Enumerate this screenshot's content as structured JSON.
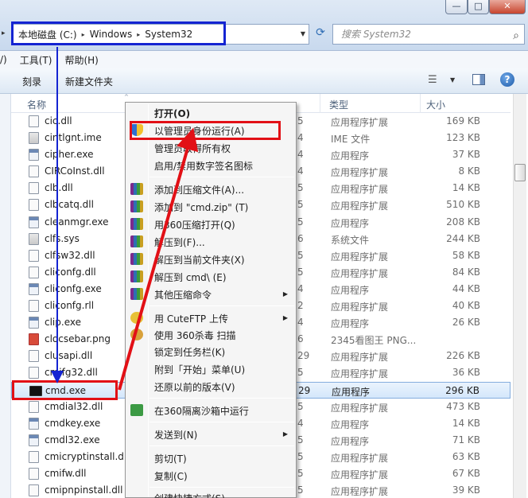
{
  "window": {
    "minimize": "—",
    "maximize": "□",
    "close": "✕"
  },
  "address": {
    "crumbs": [
      "本地磁盘 (C:)",
      "Windows",
      "System32"
    ],
    "separator": "▸"
  },
  "search": {
    "placeholder": "搜索 System32"
  },
  "menubar": [
    "/)",
    "工具(T)",
    "帮助(H)"
  ],
  "toolbar": {
    "burn": "刻录",
    "new_folder": "新建文件夹"
  },
  "columns": {
    "name": "名称",
    "type": "类型",
    "size": "大小"
  },
  "files": [
    {
      "name": "cic.dll",
      "num": "5",
      "type": "应用程序扩展",
      "size": "169 KB",
      "icon": "dll"
    },
    {
      "name": "cintlgnt.ime",
      "num": "4",
      "type": "IME 文件",
      "size": "123 KB",
      "icon": "sys"
    },
    {
      "name": "cipher.exe",
      "num": "4",
      "type": "应用程序",
      "size": "37 KB",
      "icon": "exe"
    },
    {
      "name": "CIRCoInst.dll",
      "num": "4",
      "type": "应用程序扩展",
      "size": "8 KB",
      "icon": "dll"
    },
    {
      "name": "clb.dll",
      "num": "5",
      "type": "应用程序扩展",
      "size": "14 KB",
      "icon": "dll"
    },
    {
      "name": "clbcatq.dll",
      "num": "5",
      "type": "应用程序扩展",
      "size": "510 KB",
      "icon": "dll"
    },
    {
      "name": "cleanmgr.exe",
      "num": "5",
      "type": "应用程序",
      "size": "208 KB",
      "icon": "exe"
    },
    {
      "name": "clfs.sys",
      "num": "6",
      "type": "系统文件",
      "size": "244 KB",
      "icon": "sys"
    },
    {
      "name": "clfsw32.dll",
      "num": "5",
      "type": "应用程序扩展",
      "size": "58 KB",
      "icon": "dll"
    },
    {
      "name": "cliconfg.dll",
      "num": "5",
      "type": "应用程序扩展",
      "size": "84 KB",
      "icon": "dll"
    },
    {
      "name": "cliconfg.exe",
      "num": "4",
      "type": "应用程序",
      "size": "44 KB",
      "icon": "exe"
    },
    {
      "name": "cliconfg.rll",
      "num": "2",
      "type": "应用程序扩展",
      "size": "40 KB",
      "icon": "dll"
    },
    {
      "name": "clip.exe",
      "num": "4",
      "type": "应用程序",
      "size": "26 KB",
      "icon": "exe"
    },
    {
      "name": "clocsebar.png",
      "num": "6",
      "type": "2345看图王 PNG...",
      "size": "",
      "icon": "png"
    },
    {
      "name": "clusapi.dll",
      "num": "29",
      "type": "应用程序扩展",
      "size": "226 KB",
      "icon": "dll"
    },
    {
      "name": "cmifg32.dll",
      "num": "5",
      "type": "应用程序扩展",
      "size": "36 KB",
      "icon": "dll"
    },
    {
      "name": "cmd.exe",
      "num": "29",
      "type": "应用程序",
      "size": "296 KB",
      "icon": "cmd",
      "selected": true
    },
    {
      "name": "cmdial32.dll",
      "num": "5",
      "type": "应用程序扩展",
      "size": "473 KB",
      "icon": "dll"
    },
    {
      "name": "cmdkey.exe",
      "num": "4",
      "type": "应用程序",
      "size": "14 KB",
      "icon": "exe"
    },
    {
      "name": "cmdl32.exe",
      "num": "5",
      "type": "应用程序",
      "size": "71 KB",
      "icon": "exe"
    },
    {
      "name": "cmicryptinstall.dll",
      "num": "5",
      "type": "应用程序扩展",
      "size": "63 KB",
      "icon": "dll"
    },
    {
      "name": "cmifw.dll",
      "num": "5",
      "type": "应用程序扩展",
      "size": "67 KB",
      "icon": "dll"
    },
    {
      "name": "cmipnpinstall.dll",
      "num": "5",
      "type": "应用程序扩展",
      "size": "39 KB",
      "icon": "dll"
    }
  ],
  "context_menu": {
    "open": "打开(O)",
    "run_as_admin": "以管理员身份运行(A)",
    "take_ownership": "管理员取得所有权",
    "signature": "启用/禁用数字签名图标",
    "add_archive": "添加到压缩文件(A)...",
    "add_zip": "添加到 \"cmd.zip\" (T)",
    "open_360zip": "用360压缩打开(Q)",
    "extract": "解压到(F)...",
    "extract_here": "解压到当前文件夹(X)",
    "extract_cmd": "解压到 cmd\\ (E)",
    "other_compress": "其他压缩命令",
    "cuteftp": "用 CuteFTP 上传",
    "scan_360": "使用 360杀毒 扫描",
    "pin_taskbar": "锁定到任务栏(K)",
    "pin_start": "附到「开始」菜单(U)",
    "restore": "还原以前的版本(V)",
    "sandbox": "在360隔离沙箱中运行",
    "send_to": "发送到(N)",
    "cut": "剪切(T)",
    "copy": "复制(C)",
    "create_shortcut": "创建快捷方式(S)"
  },
  "colors": {
    "highlight_red": "#e21016",
    "highlight_blue": "#1424d2",
    "selection_bg": "#d4e7fb"
  }
}
